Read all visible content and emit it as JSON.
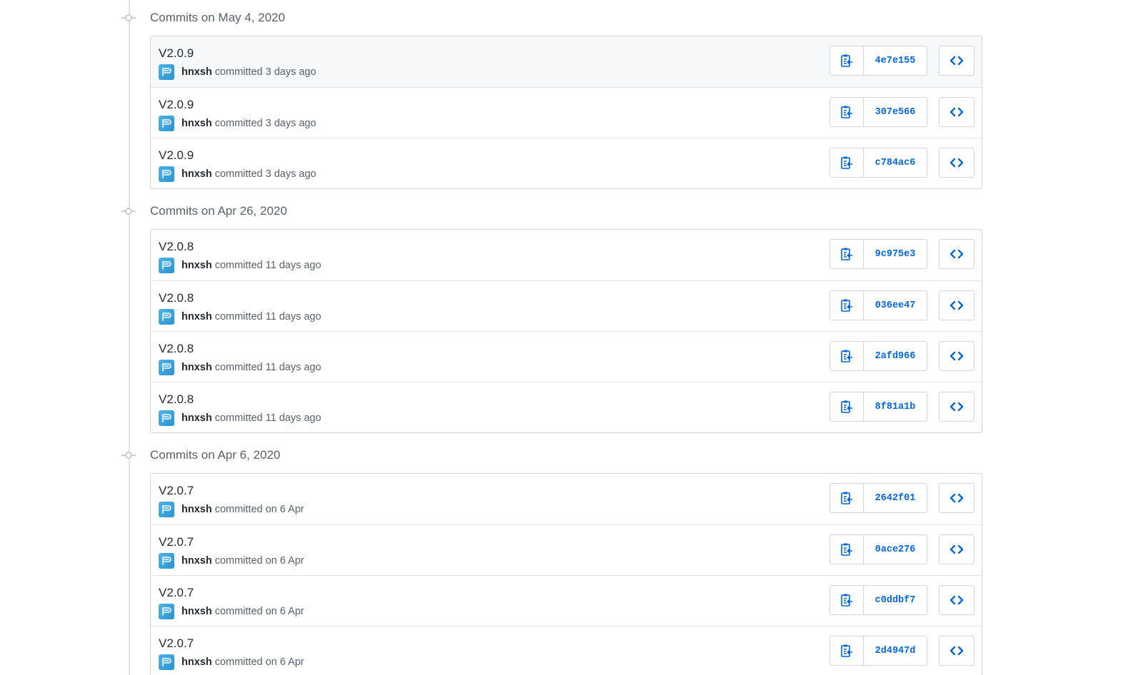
{
  "groups": [
    {
      "header": "Commits on May 4, 2020",
      "commits": [
        {
          "title": "V2.0.9",
          "author": "hnxsh",
          "when": "committed 3 days ago",
          "sha": "4e7e155",
          "highlight": true
        },
        {
          "title": "V2.0.9",
          "author": "hnxsh",
          "when": "committed 3 days ago",
          "sha": "307e566"
        },
        {
          "title": "V2.0.9",
          "author": "hnxsh",
          "when": "committed 3 days ago",
          "sha": "c784ac6"
        }
      ]
    },
    {
      "header": "Commits on Apr 26, 2020",
      "commits": [
        {
          "title": "V2.0.8",
          "author": "hnxsh",
          "when": "committed 11 days ago",
          "sha": "9c975e3"
        },
        {
          "title": "V2.0.8",
          "author": "hnxsh",
          "when": "committed 11 days ago",
          "sha": "036ee47"
        },
        {
          "title": "V2.0.8",
          "author": "hnxsh",
          "when": "committed 11 days ago",
          "sha": "2afd966"
        },
        {
          "title": "V2.0.8",
          "author": "hnxsh",
          "when": "committed 11 days ago",
          "sha": "8f81a1b"
        }
      ]
    },
    {
      "header": "Commits on Apr 6, 2020",
      "commits": [
        {
          "title": "V2.0.7",
          "author": "hnxsh",
          "when": "committed on 6 Apr",
          "sha": "2642f01"
        },
        {
          "title": "V2.0.7",
          "author": "hnxsh",
          "when": "committed on 6 Apr",
          "sha": "0ace276"
        },
        {
          "title": "V2.0.7",
          "author": "hnxsh",
          "when": "committed on 6 Apr",
          "sha": "c0ddbf7"
        },
        {
          "title": "V2.0.7",
          "author": "hnxsh",
          "when": "committed on 6 Apr",
          "sha": "2d4947d"
        }
      ]
    }
  ],
  "icons": {
    "timeline_node": "git-commit-icon",
    "copy": "clippy-icon",
    "browse": "code-icon",
    "avatar": "author-avatar"
  },
  "colors": {
    "link": "#0366d6",
    "border": "#d1d5da",
    "muted": "#586069",
    "avatar": "#2b93d1"
  }
}
